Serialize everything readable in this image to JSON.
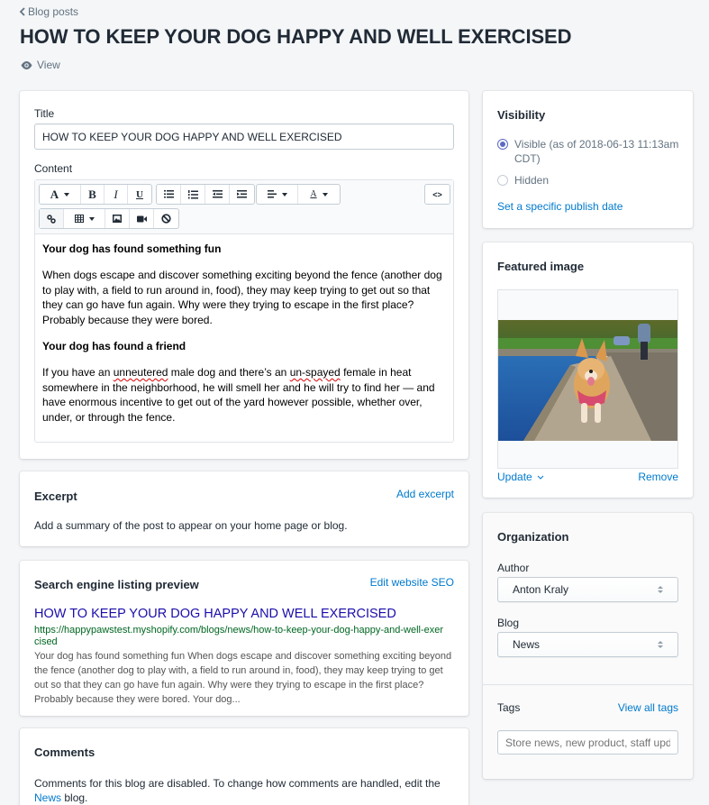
{
  "header": {
    "breadcrumb": "Blog posts",
    "title": "HOW TO KEEP YOUR DOG HAPPY AND WELL EXERCISED",
    "view_label": "View"
  },
  "main": {
    "title_label": "Title",
    "title_value": "HOW TO KEEP YOUR DOG HAPPY AND WELL EXERCISED",
    "content_label": "Content",
    "toolbar": {
      "row1": [
        {
          "name": "font-style",
          "glyph": "A",
          "dropdown": true
        },
        {
          "name": "bold",
          "glyph": "B"
        },
        {
          "name": "italic",
          "glyph": "I"
        },
        {
          "name": "underline",
          "glyph": "U"
        },
        {
          "name": "bulleted-list"
        },
        {
          "name": "numbered-list"
        },
        {
          "name": "outdent"
        },
        {
          "name": "indent"
        },
        {
          "name": "align",
          "dropdown": true
        },
        {
          "name": "text-color",
          "glyph": "A",
          "dropdown": true
        }
      ],
      "html_toggle": "<>",
      "row2": [
        {
          "name": "link"
        },
        {
          "name": "table",
          "dropdown": true
        },
        {
          "name": "image"
        },
        {
          "name": "video"
        },
        {
          "name": "clear-formatting"
        }
      ]
    },
    "content": {
      "heading1": "Your dog has found something fun",
      "para1": "When dogs escape and discover something exciting beyond the fence (another dog to play with, a field to run around in, food), they may keep trying to get out so that they can go have fun again. Why were they trying to escape in the first place? Probably because they were bored.",
      "heading2": "Your dog has found a friend",
      "para2_a": "If you have an ",
      "para2_misspelled1": "unneutered",
      "para2_b": " male dog and there’s an ",
      "para2_misspelled2": "un-spayed",
      "para2_c": " female in heat somewhere in the neighborhood, he will smell her and he will try to find her — and have enormous incentive to get out of the yard however possible, whether over, under, or through the fence."
    }
  },
  "excerpt": {
    "heading": "Excerpt",
    "action": "Add excerpt",
    "description": "Add a summary of the post to appear on your home page or blog."
  },
  "seo": {
    "heading": "Search engine listing preview",
    "action": "Edit website SEO",
    "title": "HOW TO KEEP YOUR DOG HAPPY AND WELL EXERCISED",
    "url": "https://happypawstest.myshopify.com/blogs/news/how-to-keep-your-dog-happy-and-well-exercised",
    "description": "Your dog has found something fun When dogs escape and discover something exciting beyond the fence (another dog to play with, a field to run around in, food), they may keep trying to get out so that they can go have fun again. Why were they trying to escape in the first place? Probably because they were bored. Your dog..."
  },
  "comments": {
    "heading": "Comments",
    "text_before": "Comments for this blog are disabled. To change how comments are handled, edit the ",
    "blog_link": "News",
    "text_after": " blog."
  },
  "visibility": {
    "heading": "Visibility",
    "options": [
      {
        "label": "Visible (as of 2018-06-13 11:13am CDT)",
        "checked": true
      },
      {
        "label": "Hidden",
        "checked": false
      }
    ],
    "publish_link": "Set a specific publish date"
  },
  "featured_image": {
    "heading": "Featured image",
    "alt": "Corgi running along a waterside ledge",
    "update_label": "Update",
    "remove_label": "Remove"
  },
  "organization": {
    "heading": "Organization",
    "author_label": "Author",
    "author_value": "Anton Kraly",
    "blog_label": "Blog",
    "blog_value": "News",
    "tags_label": "Tags",
    "view_all_tags": "View all tags",
    "tags_placeholder": "Store news, new product, staff updates"
  },
  "colors": {
    "accent_link": "#007ace",
    "radio_checked": "#5c6ac4",
    "seo_title": "#1a0dab",
    "seo_url": "#006621",
    "page_bg": "#f4f6f8"
  }
}
